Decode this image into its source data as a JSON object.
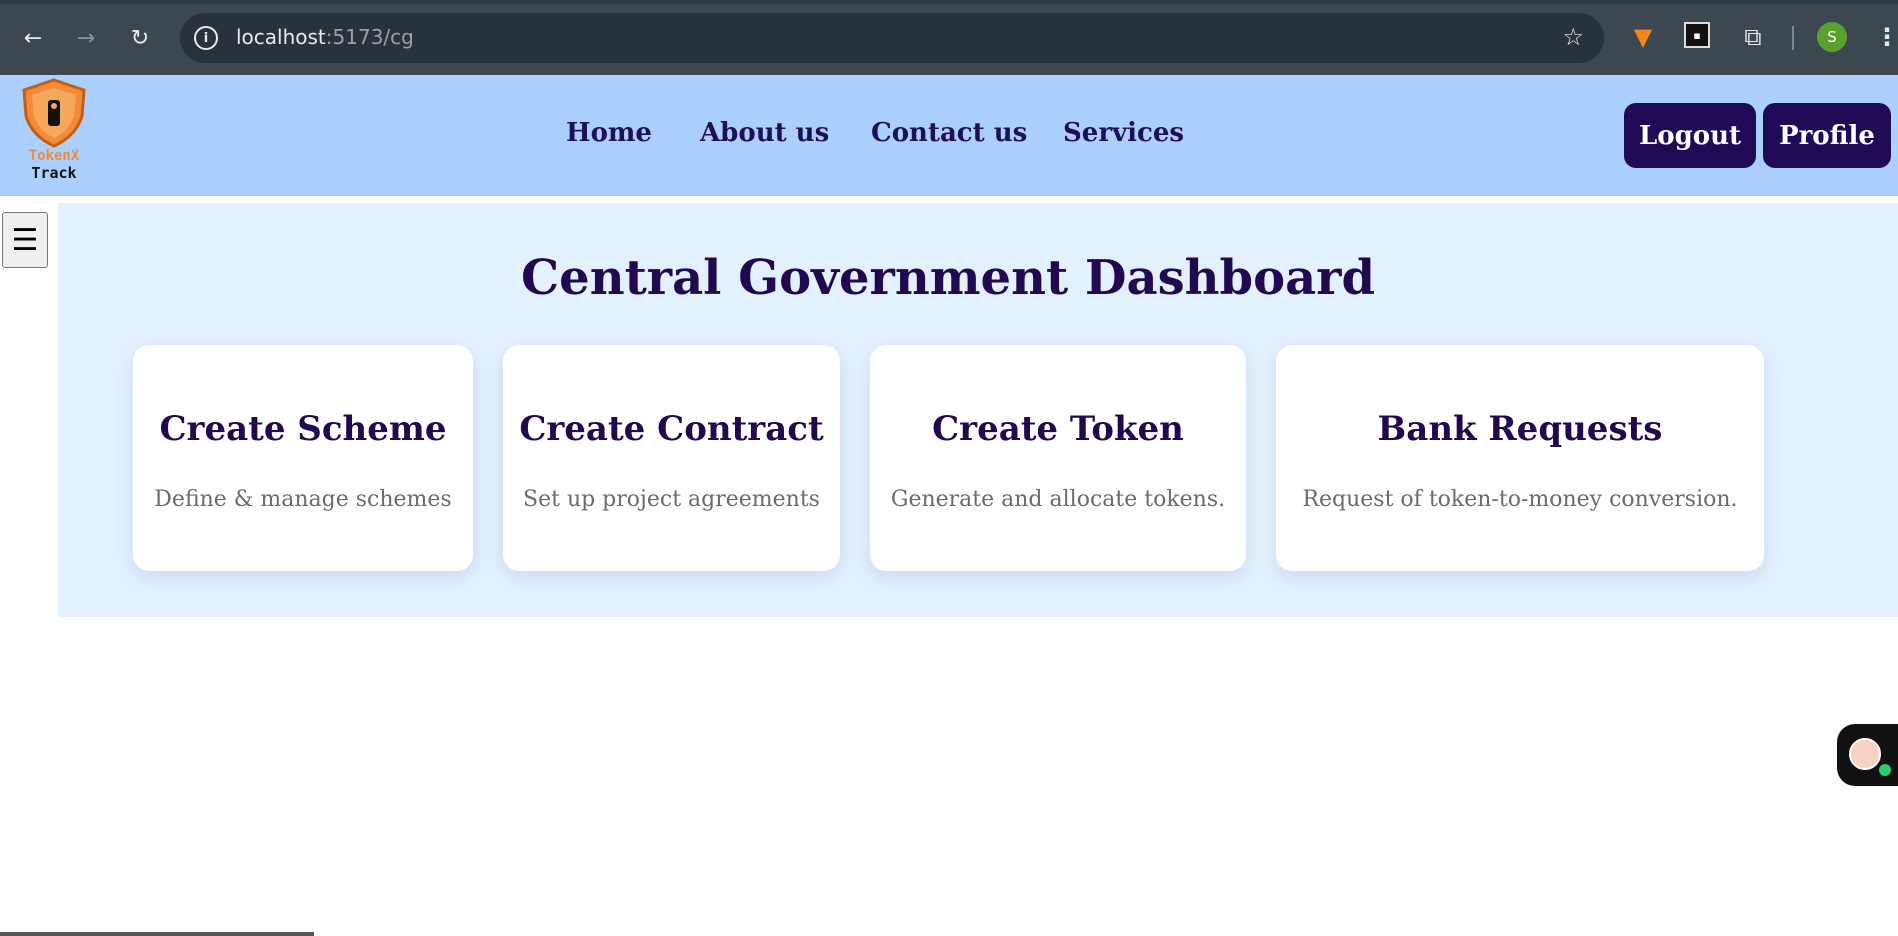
{
  "browser": {
    "url_host": "localhost",
    "url_path": ":5173/cg",
    "avatar_letter": "S"
  },
  "header": {
    "logo_line1": "TokenX",
    "logo_line2": "Track",
    "nav": [
      "Home",
      "About us",
      "Contact us",
      "Services"
    ],
    "logout_label": "Logout",
    "profile_label": "Profile",
    "colors": {
      "header_bg": "#acd0fd",
      "button_bg": "#200a56",
      "accent_orange": "#f28c3a"
    }
  },
  "sidebar": {
    "toggle_glyph": "☰"
  },
  "main": {
    "title": "Central Government Dashboard",
    "cards": [
      {
        "title": "Create Scheme",
        "description": "Define & manage schemes"
      },
      {
        "title": "Create Contract",
        "description": "Set up project agreements"
      },
      {
        "title": "Create Token",
        "description": "Generate and allocate tokens."
      },
      {
        "title": "Bank Requests",
        "description": "Request of token-to-money conversion."
      }
    ]
  }
}
